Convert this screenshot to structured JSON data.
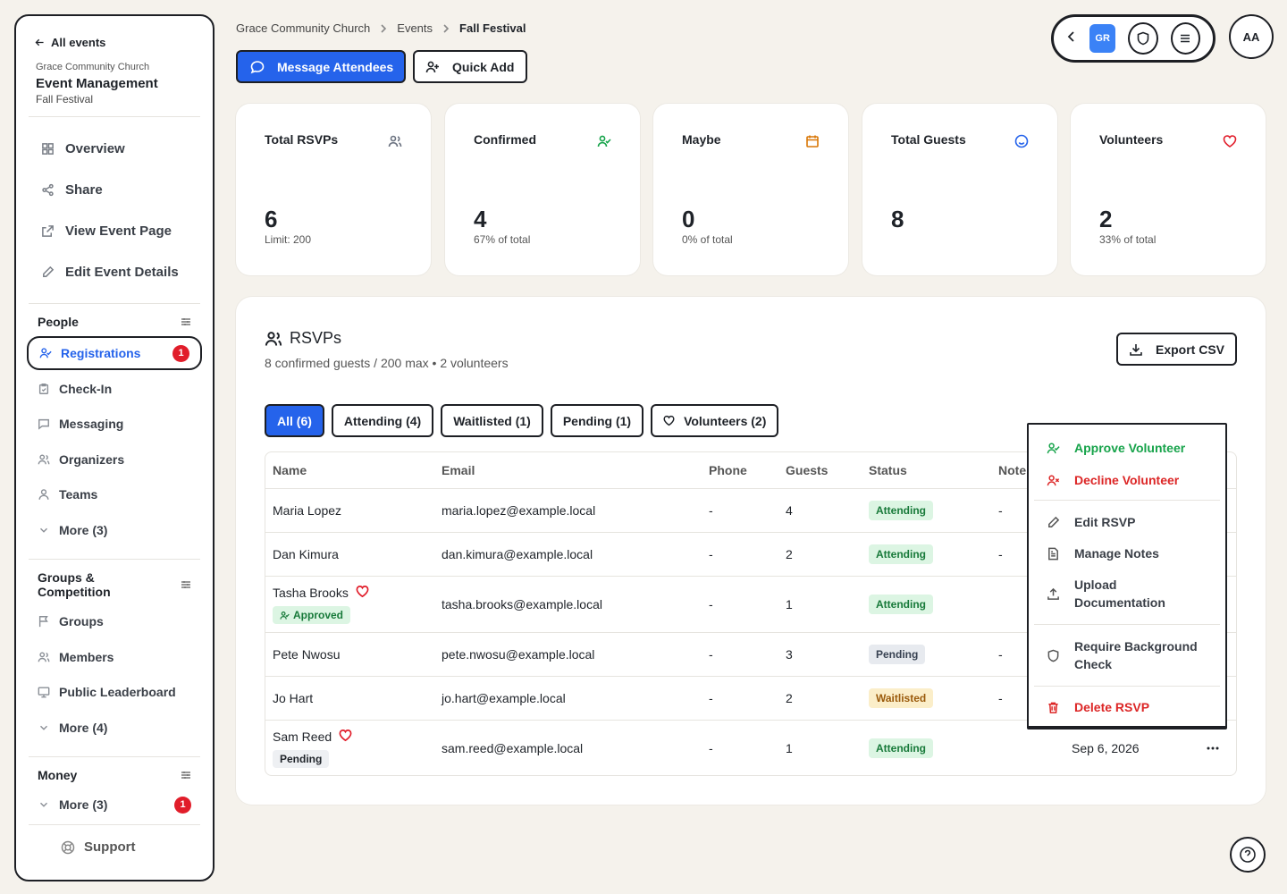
{
  "sidebar": {
    "back_label": "All events",
    "org_name": "Grace Community Church",
    "app_title": "Event Management",
    "event_name": "Fall Festival",
    "main_items": [
      {
        "label": "Overview",
        "icon": "grid-icon"
      },
      {
        "label": "Share",
        "icon": "share-icon"
      },
      {
        "label": "View Event Page",
        "icon": "external-link-icon"
      },
      {
        "label": "Edit Event Details",
        "icon": "pencil-icon"
      }
    ],
    "people": {
      "title": "People",
      "items": [
        {
          "label": "Registrations",
          "icon": "user-check-icon",
          "badge": "1"
        },
        {
          "label": "Check-In",
          "icon": "clipboard-icon"
        },
        {
          "label": "Messaging",
          "icon": "message-icon"
        },
        {
          "label": "Organizers",
          "icon": "users-icon"
        },
        {
          "label": "Teams",
          "icon": "user-icon"
        },
        {
          "label": "More (3)",
          "icon": "chevron-down-icon"
        }
      ]
    },
    "groups": {
      "title": "Groups & Competition",
      "items": [
        {
          "label": "Groups",
          "icon": "flag-icon"
        },
        {
          "label": "Members",
          "icon": "users-icon"
        },
        {
          "label": "Public Leaderboard",
          "icon": "monitor-icon"
        },
        {
          "label": "More (4)",
          "icon": "chevron-down-icon"
        }
      ]
    },
    "money": {
      "title": "Money",
      "items": [
        {
          "label": "More (3)",
          "icon": "chevron-down-icon",
          "badge": "1"
        }
      ]
    },
    "support_label": "Support"
  },
  "header": {
    "breadcrumb": [
      "Grace Community Church",
      "Events",
      "Fall Festival"
    ],
    "message_btn": "Message Attendees",
    "quick_add_btn": "Quick Add",
    "org_badge": "GR",
    "avatar": "AA"
  },
  "stats": [
    {
      "label": "Total RSVPs",
      "value": "6",
      "sub": "Limit: 200",
      "icon": "users-icon",
      "color": "#6b7280"
    },
    {
      "label": "Confirmed",
      "value": "4",
      "sub": "67% of total",
      "icon": "user-check-icon",
      "color": "#16a34a"
    },
    {
      "label": "Maybe",
      "value": "0",
      "sub": "0% of total",
      "icon": "calendar-icon",
      "color": "#d97706"
    },
    {
      "label": "Total Guests",
      "value": "8",
      "sub": "",
      "icon": "smile-icon",
      "color": "#2563eb"
    },
    {
      "label": "Volunteers",
      "value": "2",
      "sub": "33% of total",
      "icon": "heart-icon",
      "color": "#e11d2a"
    }
  ],
  "rsvps": {
    "title": "RSVPs",
    "subtitle": "8 confirmed guests / 200 max • 2 volunteers",
    "export_label": "Export CSV",
    "filters": [
      "All (6)",
      "Attending (4)",
      "Waitlisted (1)",
      "Pending (1)",
      "Volunteers (2)"
    ],
    "columns": [
      "Name",
      "Email",
      "Phone",
      "Guests",
      "Status",
      "Note"
    ],
    "rows": [
      {
        "name": "Maria Lopez",
        "email": "maria.lopez@example.local",
        "phone": "-",
        "guests": "4",
        "status": "Attending",
        "note": "-"
      },
      {
        "name": "Dan Kimura",
        "email": "dan.kimura@example.local",
        "phone": "-",
        "guests": "2",
        "status": "Attending",
        "note": "-"
      },
      {
        "name": "Tasha Brooks",
        "email": "tasha.brooks@example.local",
        "phone": "-",
        "guests": "1",
        "status": "Attending",
        "note": "",
        "volunteer": true,
        "vol_status": "Approved"
      },
      {
        "name": "Pete Nwosu",
        "email": "pete.nwosu@example.local",
        "phone": "-",
        "guests": "3",
        "status": "Pending",
        "note": "-"
      },
      {
        "name": "Jo Hart",
        "email": "jo.hart@example.local",
        "phone": "-",
        "guests": "2",
        "status": "Waitlisted",
        "note": "-"
      },
      {
        "name": "Sam Reed",
        "email": "sam.reed@example.local",
        "phone": "-",
        "guests": "1",
        "status": "Attending",
        "note": "",
        "volunteer": true,
        "vol_status": "Pending",
        "date": "Sep 6, 2026"
      }
    ]
  },
  "menu": {
    "approve": "Approve Volunteer",
    "decline": "Decline Volunteer",
    "edit": "Edit RSVP",
    "notes": "Manage Notes",
    "upload": "Upload Documentation",
    "background": "Require Background Check",
    "delete": "Delete RSVP"
  }
}
